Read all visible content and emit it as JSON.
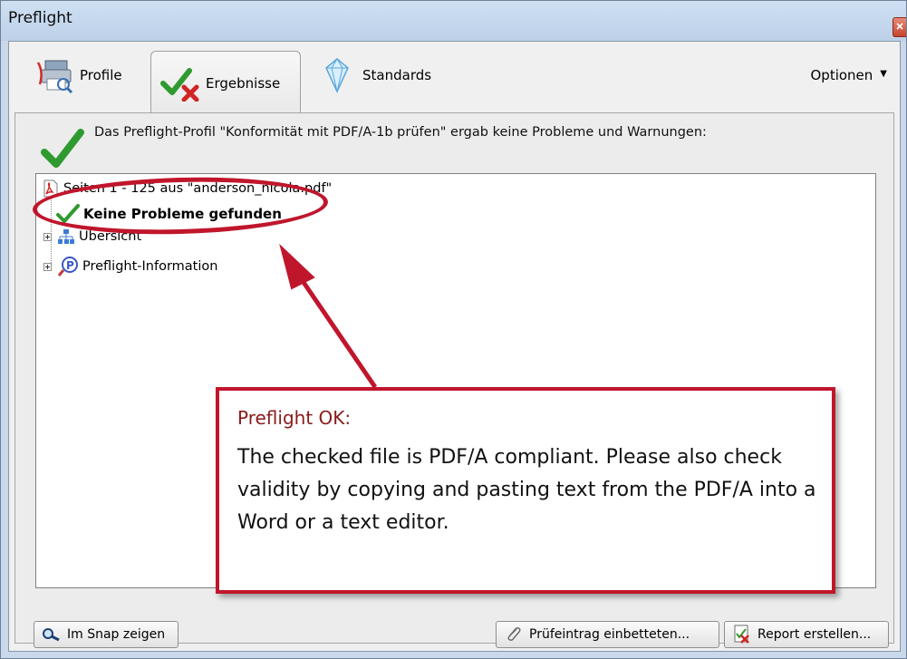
{
  "window": {
    "title": "Preflight"
  },
  "tabs": [
    {
      "label": "Profile",
      "icon": "profile-icon"
    },
    {
      "label": "Ergebnisse",
      "icon": "check-cross-icon"
    },
    {
      "label": "Standards",
      "icon": "diamond-icon"
    }
  ],
  "options_label": "Optionen",
  "status": {
    "message": "Das Preflight-Profil \"Konformität mit PDF/A-1b prüfen\" ergab keine Probleme und Warnungen:"
  },
  "tree": {
    "root_label": "Seiten 1 - 125 aus \"anderson_nicola.pdf\"",
    "result_label": "Keine Probleme gefunden",
    "overview_label": "Übersicht",
    "info_label": "Preflight-Information"
  },
  "callout": {
    "title": "Preflight OK:",
    "body": "The checked file is PDF/A compliant. Please also check validity by copying and pasting text from the PDF/A into a Word or a text editor."
  },
  "buttons": {
    "snap": "Im Snap zeigen",
    "embed": "Prüfeintrag einbetteten...",
    "report": "Report erstellen..."
  },
  "colors": {
    "annotation_red": "#c0162c",
    "check_green": "#2f9a2f"
  }
}
